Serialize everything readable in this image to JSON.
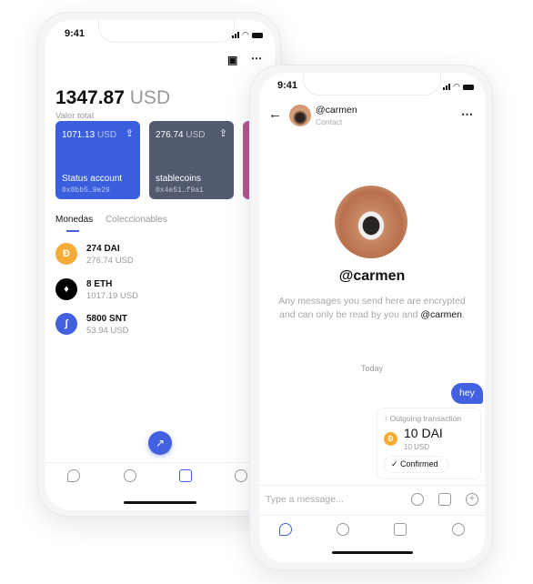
{
  "wallet": {
    "status_time": "9:41",
    "balance": "1347.87",
    "currency": "USD",
    "balance_label": "Valor total",
    "cards": [
      {
        "amount": "1071.13",
        "currency": "USD",
        "name": "Status account",
        "address": "0x8bb5…9e29",
        "color": "#3b5fdc"
      },
      {
        "amount": "276.74",
        "currency": "USD",
        "name": "stablecoins",
        "address": "0x4e51…f9a1",
        "color": "#525a70"
      },
      {
        "amount": "",
        "currency": "",
        "name": "",
        "address": "",
        "color": "#b55590"
      }
    ],
    "tabs": [
      {
        "label": "Monedas",
        "active": true
      },
      {
        "label": "Coleccionables",
        "active": false
      }
    ],
    "assets": [
      {
        "amount": "274 DAI",
        "value": "276.74 USD",
        "icon": "dai-icon",
        "color": "#f5ac37"
      },
      {
        "amount": "8 ETH",
        "value": "1017.19 USD",
        "icon": "eth-icon",
        "color": "#000000"
      },
      {
        "amount": "5800 SNT",
        "value": "53.94 USD",
        "icon": "snt-icon",
        "color": "#4360df"
      }
    ],
    "nav": [
      "chat-icon",
      "browser-icon",
      "wallet-icon",
      "profile-icon"
    ],
    "active_nav": "wallet-icon"
  },
  "chat": {
    "status_time": "9:41",
    "contact_name": "@carmen",
    "contact_sub": "Contact",
    "profile_name": "@carmen",
    "intro_text": "Any messages you send here are encrypted and can only be read by you and",
    "intro_handle": "@carmen",
    "intro_end": ".",
    "date_divider": "Today",
    "messages": [
      {
        "text": "hey",
        "outgoing": true
      }
    ],
    "transaction": {
      "label": "↑ Outgoing transaction",
      "amount": "10 DAI",
      "value": "10 USD",
      "status": "Confirmed"
    },
    "input_placeholder": "Type a message...",
    "accent": "#4360df",
    "active_nav": "chat-icon"
  }
}
